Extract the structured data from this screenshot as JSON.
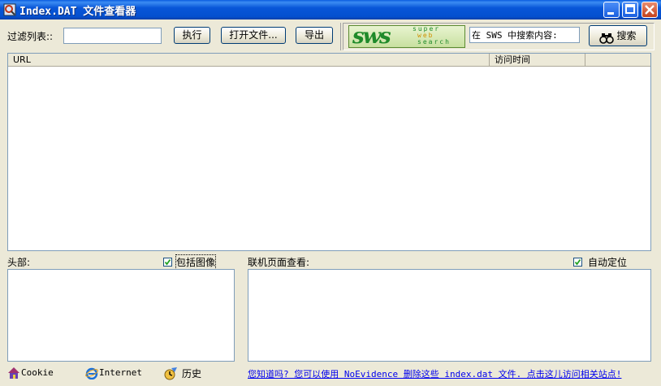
{
  "window": {
    "title": "Index.DAT 文件查看器"
  },
  "toolbar": {
    "filter_label": "过滤列表::",
    "filter_value": "",
    "execute_label": "执行",
    "open_file_label": "打开文件...",
    "export_label": "导出"
  },
  "sws": {
    "logo_text": "sws",
    "logo_words": [
      "super",
      "web",
      "search"
    ],
    "search_value": "在 SWS 中搜索内容:",
    "search_button_label": "搜索"
  },
  "list": {
    "columns": [
      "URL",
      "访问时间",
      ""
    ],
    "rows": []
  },
  "headers_panel": {
    "label": "头部:",
    "include_images_label": "包括图像",
    "include_images_checked": true
  },
  "preview_panel": {
    "label": "联机页面查看:",
    "auto_locate_label": "自动定位",
    "auto_locate_checked": true
  },
  "footer": {
    "tabs": [
      {
        "label": "Cookie",
        "icon": "cookie-house-icon"
      },
      {
        "label": "Internet",
        "icon": "internet-explorer-icon"
      },
      {
        "label": "历史",
        "icon": "history-icon"
      }
    ],
    "link_text": "您知道吗? 您可以使用 NoEvidence 删除这些 index.dat 文件. 点击这儿访问相关站点!"
  },
  "colors": {
    "titlebar": "#0450cf",
    "face": "#ece9d8",
    "logo_green": "#1f8a2a",
    "link": "#0000ee"
  }
}
